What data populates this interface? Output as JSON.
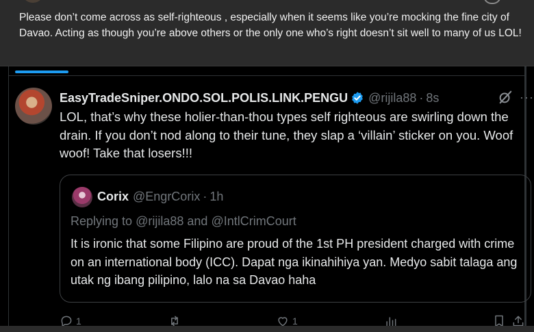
{
  "parent_post": {
    "text": "Please don’t come across as self-righteous , especially when it seems like you’re mocking the fine city of Davao. Acting as though you’re above others or the only one who’s right doesn’t sit well to many of us LOL!"
  },
  "reply": {
    "display_name": "EasyTradeSniper.ONDO.SOL.POLIS.LINK.PENGU",
    "handle": "@rijila88",
    "separator": "·",
    "time": "8s",
    "text": "LOL, that’s why these holier-than-thou types self righteous are swirling down the drain. If you don’t nod along to their tune, they slap a ‘villain’ sticker on you. Woof woof! Take that losers!!!",
    "more": "···"
  },
  "quote": {
    "display_name": "Corix",
    "handle": "@EngrCorix",
    "separator": "·",
    "time": "1h",
    "replying_prefix": "Replying to",
    "mention_1": "@rijila88",
    "replying_and": "and",
    "mention_2": "@IntlCrimCourt",
    "text": "It is ironic that some Filipino are proud of the 1st PH president charged with crime on an international body (ICC). Dapat nga ikinahihiya yan. Medyo sabit talaga ang utak ng ibang pilipino, lalo na sa Davao haha"
  },
  "actions": {
    "reply_count": "1",
    "like_count": "1"
  },
  "colors": {
    "accent": "#1d9bf0",
    "muted_text": "#71767b",
    "primary_text": "#e7e9ea"
  },
  "icons": [
    "verified-badge-icon",
    "grok-icon",
    "more-icon",
    "reply-icon",
    "repost-icon",
    "like-icon",
    "views-icon",
    "bookmark-icon",
    "share-icon"
  ]
}
